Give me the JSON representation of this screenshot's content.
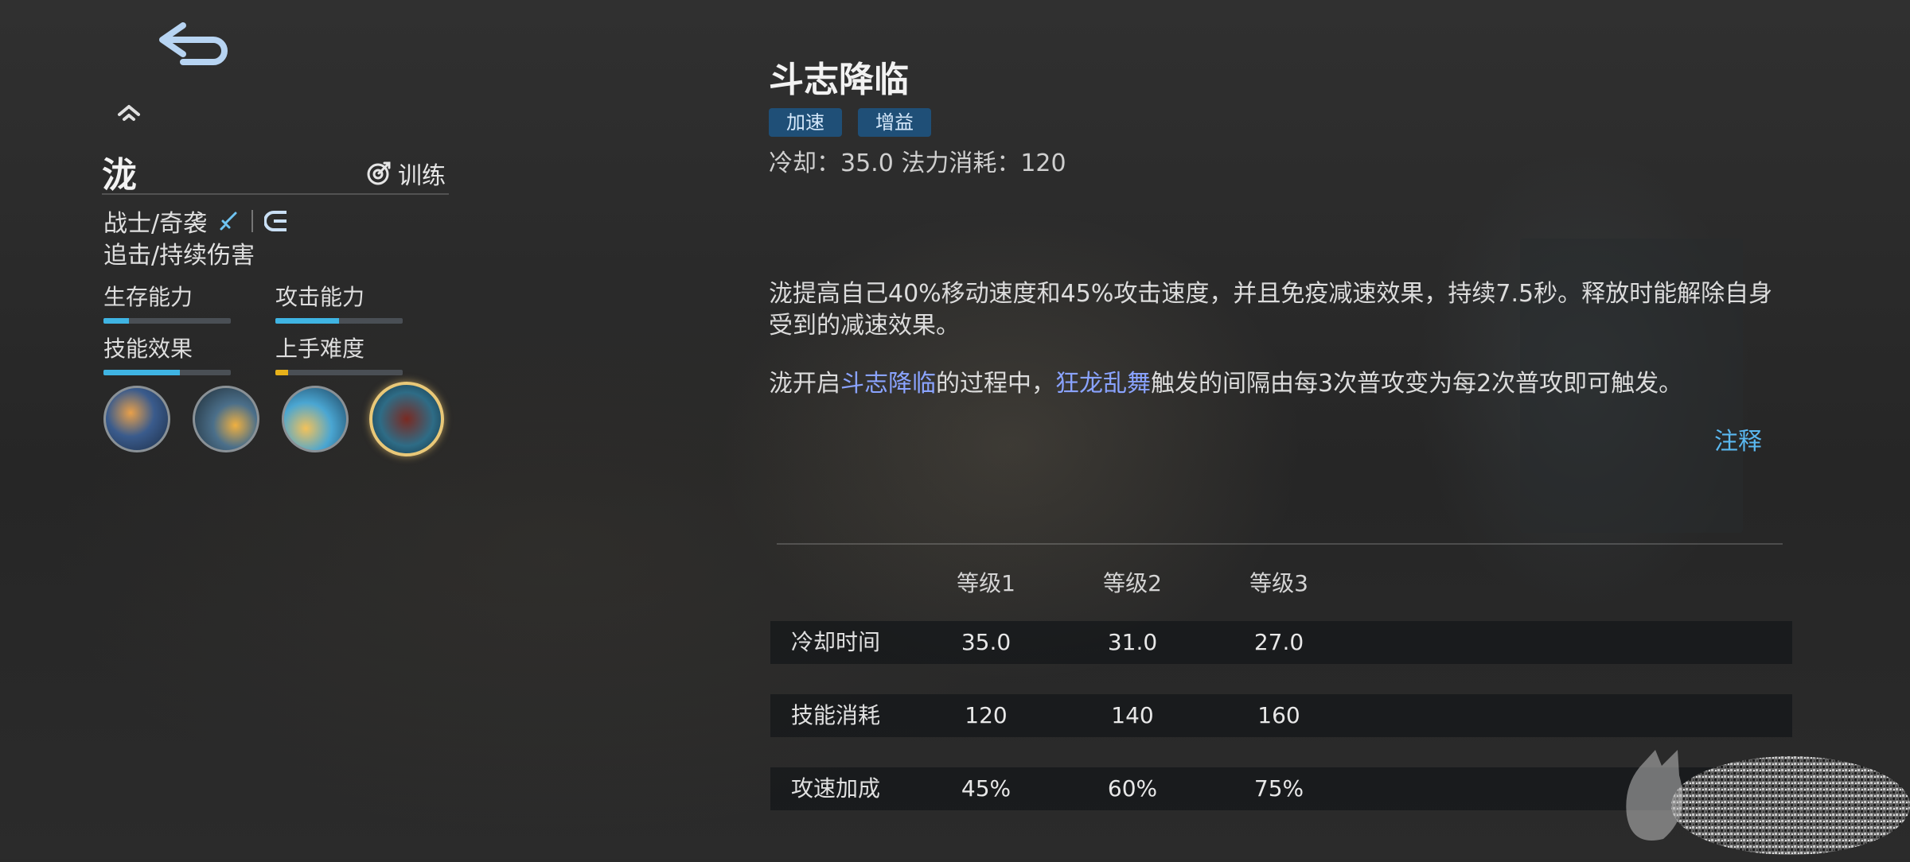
{
  "hero": {
    "name": "泷",
    "train_label": "训练",
    "role": "战士/奇袭",
    "specialty": "追击/持续伤害"
  },
  "stats": [
    {
      "label": "生存能力",
      "value": 0.2
    },
    {
      "label": "攻击能力",
      "value": 0.5
    },
    {
      "label": "技能效果",
      "value": 0.6
    },
    {
      "label": "上手难度",
      "value": 0.1
    }
  ],
  "skills": [
    {
      "icon": "skill-1-icon"
    },
    {
      "icon": "skill-2-icon"
    },
    {
      "icon": "skill-3-icon"
    },
    {
      "icon": "skill-4-icon",
      "selected": true
    }
  ],
  "skill_detail": {
    "title": "斗志降临",
    "tags": [
      "加速",
      "增益"
    ],
    "cost_line": "冷却：35.0 法力消耗：120",
    "desc1": "泷提高自己40%移动速度和45%攻击速度，并且免疫减速效果，持续7.5秒。释放时能解除自身受到的减速效果。",
    "desc2_a": "泷开启",
    "desc2_hl1": "斗志降临",
    "desc2_b": "的过程中，",
    "desc2_hl2": "狂龙乱舞",
    "desc2_c": "触发的间隔由每3次普攻变为每2次普攻即可触发。",
    "note_label": "注释"
  },
  "level_table": {
    "headers": [
      "等级1",
      "等级2",
      "等级3"
    ],
    "rows": [
      {
        "label": "冷却时间",
        "values": [
          "35.0",
          "31.0",
          "27.0"
        ]
      },
      {
        "label": "技能消耗",
        "values": [
          "120",
          "140",
          "160"
        ]
      },
      {
        "label": "攻速加成",
        "values": [
          "45%",
          "60%",
          "75%"
        ]
      }
    ]
  },
  "colors": {
    "accent_blue": "#3fb4e3",
    "accent_yellow": "#e8b21a",
    "link": "#5ab8f0",
    "highlight": "#8aa3ff",
    "tag_bg": "#1f4f77"
  }
}
